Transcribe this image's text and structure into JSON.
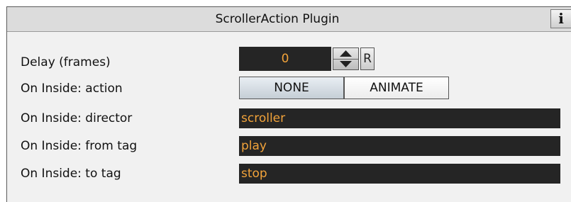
{
  "panel": {
    "title": "ScrollerAction Plugin",
    "info_label": "i"
  },
  "delay": {
    "label": "Delay (frames)",
    "value": "0",
    "reset_label": "R"
  },
  "action": {
    "label": "On Inside: action",
    "options": [
      "NONE",
      "ANIMATE"
    ],
    "selected": "NONE"
  },
  "director": {
    "label": "On Inside: director",
    "value": "scroller"
  },
  "from_tag": {
    "label": "On Inside: from tag",
    "value": "play"
  },
  "to_tag": {
    "label": "On Inside: to tag",
    "value": "stop"
  },
  "colors": {
    "field_bg": "#252525",
    "field_text": "#f2a33a",
    "panel_bg": "#f1f1f1",
    "titlebar_bg": "#dcdcdc"
  },
  "icons": {
    "info": "info-icon",
    "spinner_up": "arrow-up-icon",
    "spinner_down": "arrow-down-icon"
  }
}
